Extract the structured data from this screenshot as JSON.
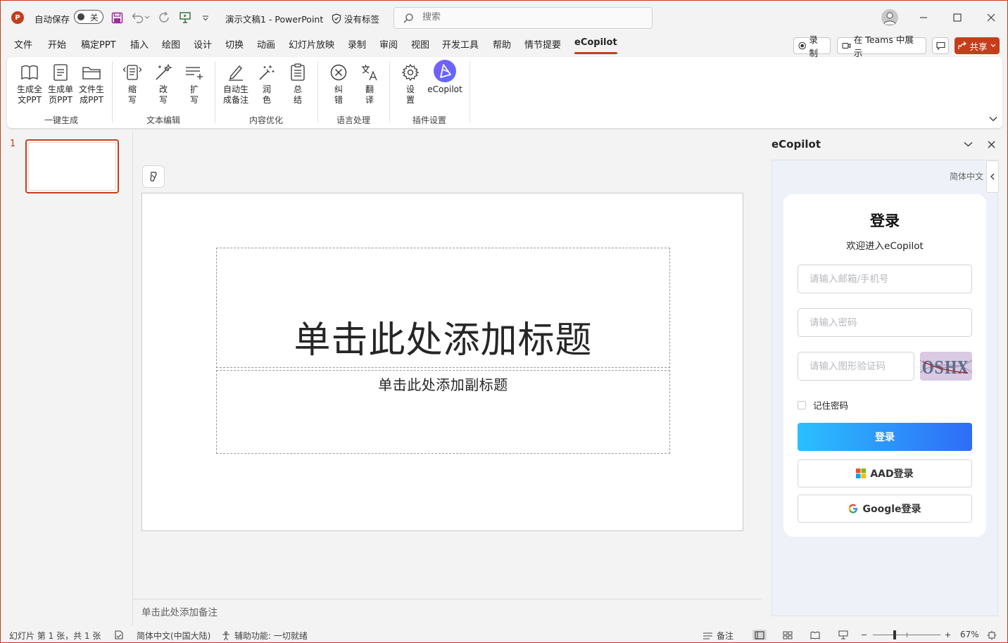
{
  "titlebar": {
    "app_logo": "P",
    "autosave_label": "自动保存",
    "autosave_state": "关",
    "doc_title": "演示文稿1  -  PowerPoint",
    "sensitivity": "没有标签",
    "search_placeholder": "搜索",
    "icons": [
      "save-icon",
      "undo-icon",
      "redo-icon",
      "present-from-start-icon",
      "customize-qat-icon",
      "user-avatar-icon",
      "minimize-icon",
      "maximize-icon",
      "close-icon"
    ]
  },
  "tabs": [
    "文件",
    "开始",
    "稿定PPT",
    "插入",
    "绘图",
    "设计",
    "切换",
    "动画",
    "幻灯片放映",
    "录制",
    "审阅",
    "视图",
    "开发工具",
    "帮助",
    "情节提要",
    "eCopilot"
  ],
  "active_tab": "eCopilot",
  "tab_actions": {
    "record": "录制",
    "teams": "在 Teams 中展示",
    "share": "共享"
  },
  "ribbon": {
    "buttons": [
      {
        "label": "生成全\n文PPT",
        "icon": "book-icon"
      },
      {
        "label": "生成单\n页PPT",
        "icon": "page-icon"
      },
      {
        "label": "文件生\n成PPT",
        "icon": "folder-icon"
      },
      {
        "label": "缩\n写",
        "icon": "condense-icon"
      },
      {
        "label": "改\n写",
        "icon": "rewrite-wand-icon"
      },
      {
        "label": "扩\n写",
        "icon": "expand-icon"
      },
      {
        "label": "自动生\n成备注",
        "icon": "pen-note-icon"
      },
      {
        "label": "润\n色",
        "icon": "polish-wand-icon"
      },
      {
        "label": "总\n结",
        "icon": "summary-icon"
      },
      {
        "label": "纠\n错",
        "icon": "correct-icon"
      },
      {
        "label": "翻\n译",
        "icon": "translate-icon"
      },
      {
        "label": "设\n置",
        "icon": "settings-icon"
      },
      {
        "label": "eCopilot",
        "icon": "ecopilot-logo-icon"
      }
    ],
    "groups": [
      "一键生成",
      "文本编辑",
      "内容优化",
      "语言处理",
      "插件设置"
    ]
  },
  "thumbnails": {
    "slide_number": "1"
  },
  "slide": {
    "title_placeholder": "单击此处添加标题",
    "subtitle_placeholder": "单击此处添加副标题"
  },
  "notes_placeholder": "单击此处添加备注",
  "taskpane": {
    "title": "eCopilot",
    "language": "简体中文",
    "login": {
      "title": "登录",
      "subtitle": "欢迎进入eCopilot",
      "email_placeholder": "请输入邮箱/手机号",
      "password_placeholder": "请输入密码",
      "captcha_placeholder": "请输入图形验证码",
      "captcha_text": "OSHX",
      "remember": "记住密码",
      "login_button": "登录",
      "aad_button": "AAD登录",
      "google_button": "Google登录"
    }
  },
  "statusbar": {
    "slide_info": "幻灯片 第 1 张，共 1 张",
    "language": "简体中文(中国大陆)",
    "accessibility": "辅助功能: 一切就绪",
    "notes": "备注",
    "zoom": "67%"
  },
  "colors": {
    "accent": "#c43e1c",
    "login_gradient_start": "#2ac0ff",
    "login_gradient_end": "#2f6cf6",
    "taskpane_bg": "#eef1f8"
  }
}
